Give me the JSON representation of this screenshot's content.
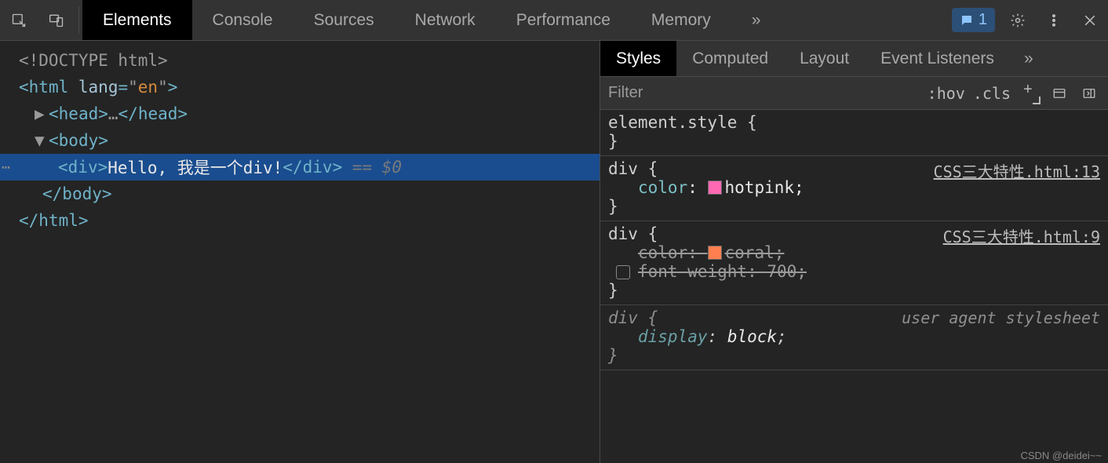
{
  "toolbar": {
    "tabs": [
      "Elements",
      "Console",
      "Sources",
      "Network",
      "Performance",
      "Memory"
    ],
    "active_tab": 0,
    "issue_count": "1"
  },
  "dom": {
    "doctype": "<!DOCTYPE html>",
    "html_open": "html",
    "lang_attr": "lang",
    "lang_val": "en",
    "head": "head",
    "head_ellipsis": "…",
    "body": "body",
    "selected": {
      "tag": "div",
      "text": "Hello, 我是一个div!",
      "suffix": " == $0"
    }
  },
  "styles": {
    "subtabs": [
      "Styles",
      "Computed",
      "Layout",
      "Event Listeners"
    ],
    "active_subtab": 0,
    "filter_placeholder": "Filter",
    "hov": ":hov",
    "cls": ".cls",
    "rules": [
      {
        "selector": "element.style",
        "props": [],
        "source": null,
        "ua": false
      },
      {
        "selector": "div",
        "source": "CSS三大特性.html:13",
        "ua": false,
        "props": [
          {
            "name": "color",
            "value": "hotpink",
            "swatch": "#ff69b4",
            "strike": false,
            "checkbox": false
          }
        ]
      },
      {
        "selector": "div",
        "source": "CSS三大特性.html:9",
        "ua": false,
        "props": [
          {
            "name": "color",
            "value": "coral",
            "swatch": "#ff7f50",
            "strike": true,
            "checkbox": false
          },
          {
            "name": "font-weight",
            "value": "700",
            "swatch": null,
            "strike": true,
            "checkbox": true
          }
        ]
      },
      {
        "selector": "div",
        "source": "user agent stylesheet",
        "ua": true,
        "props": [
          {
            "name": "display",
            "value": "block",
            "swatch": null,
            "strike": false,
            "checkbox": false
          }
        ]
      }
    ]
  },
  "watermark": "CSDN @deidei~~"
}
